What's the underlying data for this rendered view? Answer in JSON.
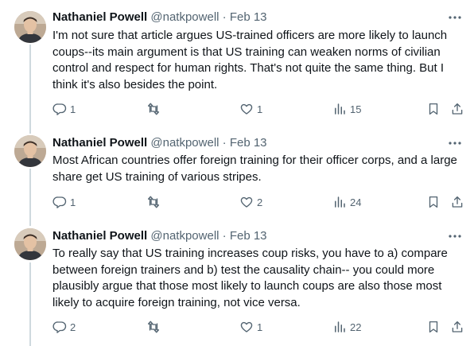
{
  "tweets": [
    {
      "author": "Nathaniel Powell",
      "handle": "@natkpowell",
      "separator": "·",
      "date": "Feb 13",
      "text": "I'm not sure that article argues US-trained officers are more likely to launch coups--its main argument is that US training can weaken norms of civilian control and respect for human rights. That's not quite the same thing. But I think it's also besides the point.",
      "replies": "1",
      "retweets": "",
      "likes": "1",
      "views": "15"
    },
    {
      "author": "Nathaniel Powell",
      "handle": "@natkpowell",
      "separator": "·",
      "date": "Feb 13",
      "text": "Most African countries offer foreign training for their officer corps, and a large share get US training of various stripes.",
      "replies": "1",
      "retweets": "",
      "likes": "2",
      "views": "24"
    },
    {
      "author": "Nathaniel Powell",
      "handle": "@natkpowell",
      "separator": "·",
      "date": "Feb 13",
      "text": "To really say that US training increases coup risks, you have to a) compare between foreign trainers and b) test the causality chain-- you could more plausibly argue that those most likely to launch coups are also those most likely to acquire foreign training, not vice versa.",
      "replies": "2",
      "retweets": "",
      "likes": "1",
      "views": "22"
    }
  ],
  "icons": {
    "more": "more-dots-icon",
    "reply": "reply-icon",
    "retweet": "retweet-icon",
    "like": "heart-icon",
    "views": "analytics-icon",
    "bookmark": "bookmark-icon",
    "share": "share-icon"
  },
  "colors": {
    "text": "#0f1419",
    "secondary": "#536471",
    "thread": "#cfd9de"
  }
}
